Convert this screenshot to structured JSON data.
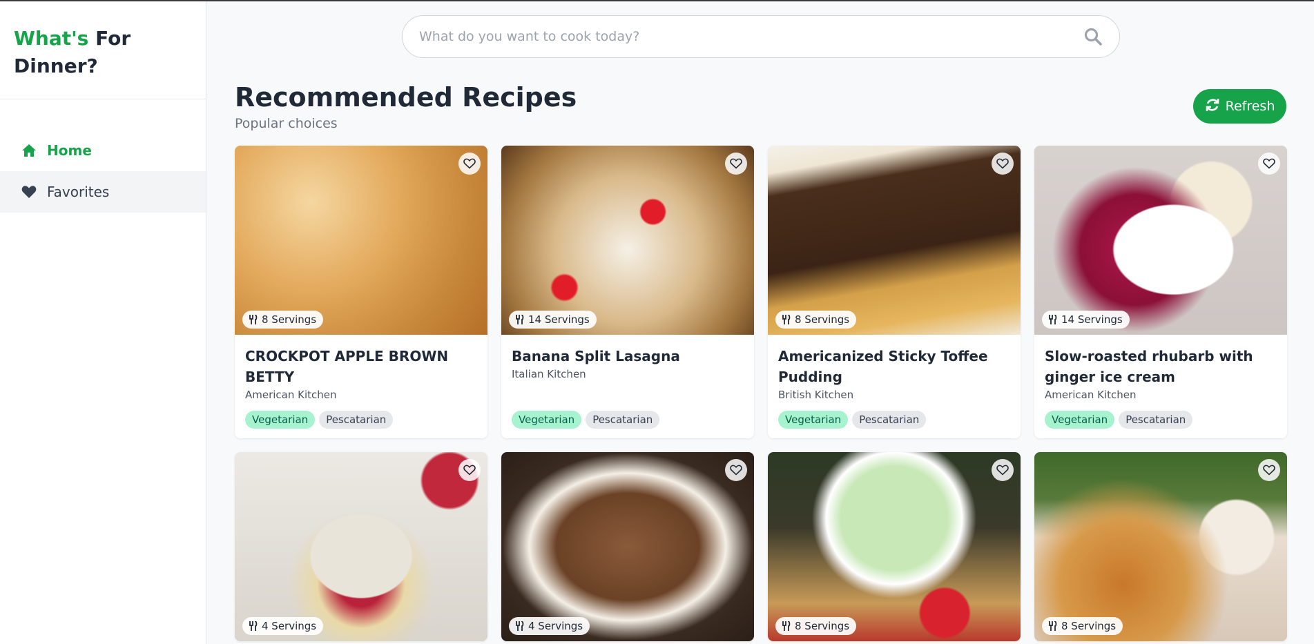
{
  "brand": {
    "part1": "What's",
    "part2": "For",
    "part3": "Dinner?"
  },
  "sidebar": {
    "items": [
      {
        "label": "Home",
        "icon": "home-icon"
      },
      {
        "label": "Favorites",
        "icon": "heart-icon"
      }
    ]
  },
  "search": {
    "placeholder": "What do you want to cook today?"
  },
  "header": {
    "title": "Recommended Recipes",
    "subtitle": "Popular choices"
  },
  "refresh": {
    "label": "Refresh"
  },
  "colors": {
    "accent": "#16a34a",
    "veg_tag": "#a7f3d0",
    "pesc_tag": "#e5e7eb"
  },
  "recipes": [
    {
      "servings": "8 Servings",
      "title": "CROCKPOT APPLE BROWN BETTY",
      "kitchen": "American Kitchen",
      "tags": [
        "Vegetarian",
        "Pescatarian"
      ]
    },
    {
      "servings": "14 Servings",
      "title": "Banana Split Lasagna",
      "kitchen": "Italian Kitchen",
      "tags": [
        "Vegetarian",
        "Pescatarian"
      ]
    },
    {
      "servings": "8 Servings",
      "title": "Americanized Sticky Toffee Pudding",
      "kitchen": "British Kitchen",
      "tags": [
        "Vegetarian",
        "Pescatarian"
      ]
    },
    {
      "servings": "14 Servings",
      "title": "Slow-roasted rhubarb with ginger ice cream",
      "kitchen": "American Kitchen",
      "tags": [
        "Vegetarian",
        "Pescatarian"
      ]
    },
    {
      "servings": "4 Servings"
    },
    {
      "servings": "4 Servings"
    },
    {
      "servings": "8 Servings"
    },
    {
      "servings": "8 Servings"
    }
  ]
}
